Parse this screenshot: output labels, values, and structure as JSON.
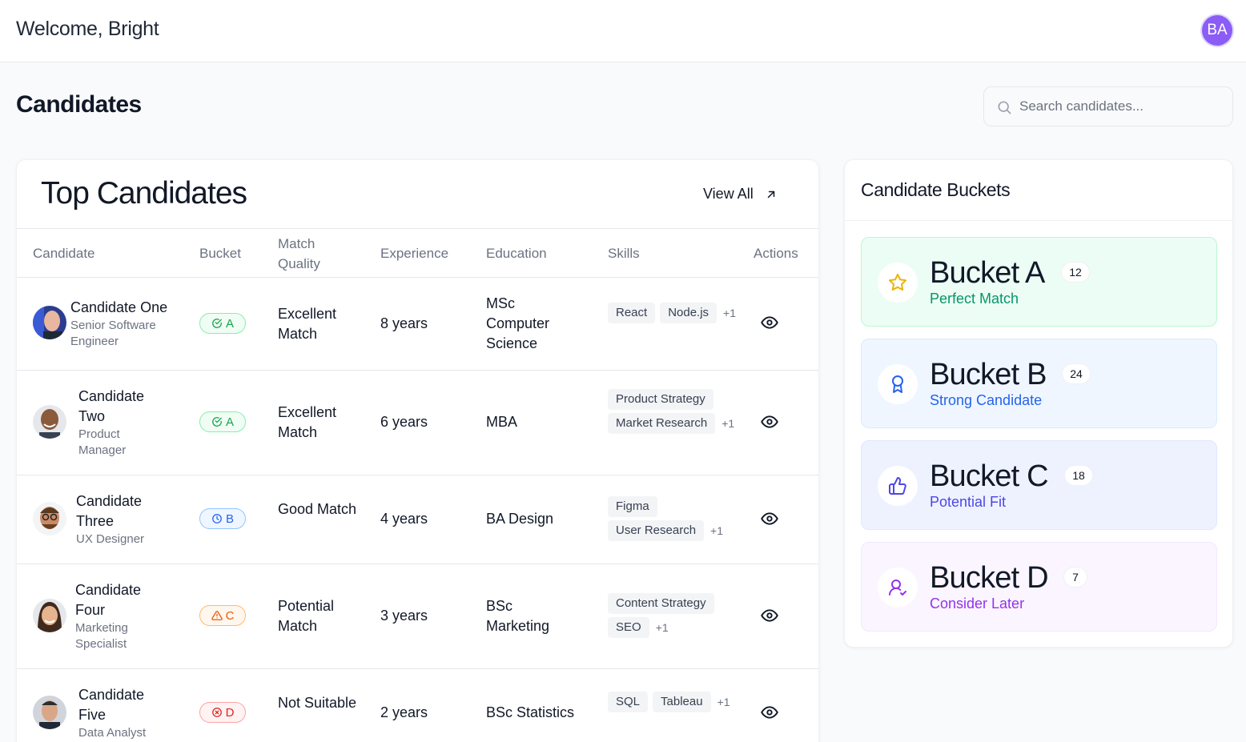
{
  "header": {
    "welcome": "Welcome, Bright",
    "avatar_initials": "BA"
  },
  "page": {
    "title": "Candidates",
    "search_placeholder": "Search candidates..."
  },
  "top_candidates": {
    "title": "Top Candidates",
    "view_all_label": "View All",
    "columns": [
      "Candidate",
      "Bucket",
      "Match Quality",
      "Experience",
      "Education",
      "Skills",
      "Actions"
    ],
    "rows": [
      {
        "name": "Candidate One",
        "role": "Senior Software Engineer",
        "bucket": "A",
        "bucket_status": "check",
        "match": "Excellent Match",
        "experience": "8 years",
        "education": "MSc Computer Science",
        "skills": [
          "React",
          "Node.js"
        ],
        "more_skills": "+1"
      },
      {
        "name": "Candidate Two",
        "role": "Product Manager",
        "bucket": "A",
        "bucket_status": "check",
        "match": "Excellent Match",
        "experience": "6 years",
        "education": "MBA",
        "skills": [
          "Product Strategy",
          "Market Research"
        ],
        "more_skills": "+1"
      },
      {
        "name": "Candidate Three",
        "role": "UX Designer",
        "bucket": "B",
        "bucket_status": "clock",
        "match": "Good Match",
        "experience": "4 years",
        "education": "BA Design",
        "skills": [
          "Figma",
          "User Research"
        ],
        "more_skills": "+1"
      },
      {
        "name": "Candidate Four",
        "role": "Marketing Specialist",
        "bucket": "C",
        "bucket_status": "warning",
        "match": "Potential Match",
        "experience": "3 years",
        "education": "BSc Marketing",
        "skills": [
          "Content Strategy",
          "SEO"
        ],
        "more_skills": "+1"
      },
      {
        "name": "Candidate Five",
        "role": "Data Analyst",
        "bucket": "D",
        "bucket_status": "x-circle",
        "match": "Not Suitable",
        "experience": "2 years",
        "education": "BSc Statistics",
        "skills": [
          "SQL",
          "Tableau"
        ],
        "more_skills": "+1"
      }
    ]
  },
  "buckets_panel": {
    "title": "Candidate Buckets",
    "buckets": [
      {
        "name": "Bucket A",
        "count": "12",
        "subtitle": "Perfect Match",
        "icon": "star-icon",
        "color": "#059669"
      },
      {
        "name": "Bucket B",
        "count": "24",
        "subtitle": "Strong Candidate",
        "icon": "award-icon",
        "color": "#2563eb"
      },
      {
        "name": "Bucket C",
        "count": "18",
        "subtitle": "Potential Fit",
        "icon": "thumbs-up-icon",
        "color": "#4f46e5"
      },
      {
        "name": "Bucket D",
        "count": "7",
        "subtitle": "Consider Later",
        "icon": "user-check-icon",
        "color": "#9333ea"
      }
    ]
  }
}
